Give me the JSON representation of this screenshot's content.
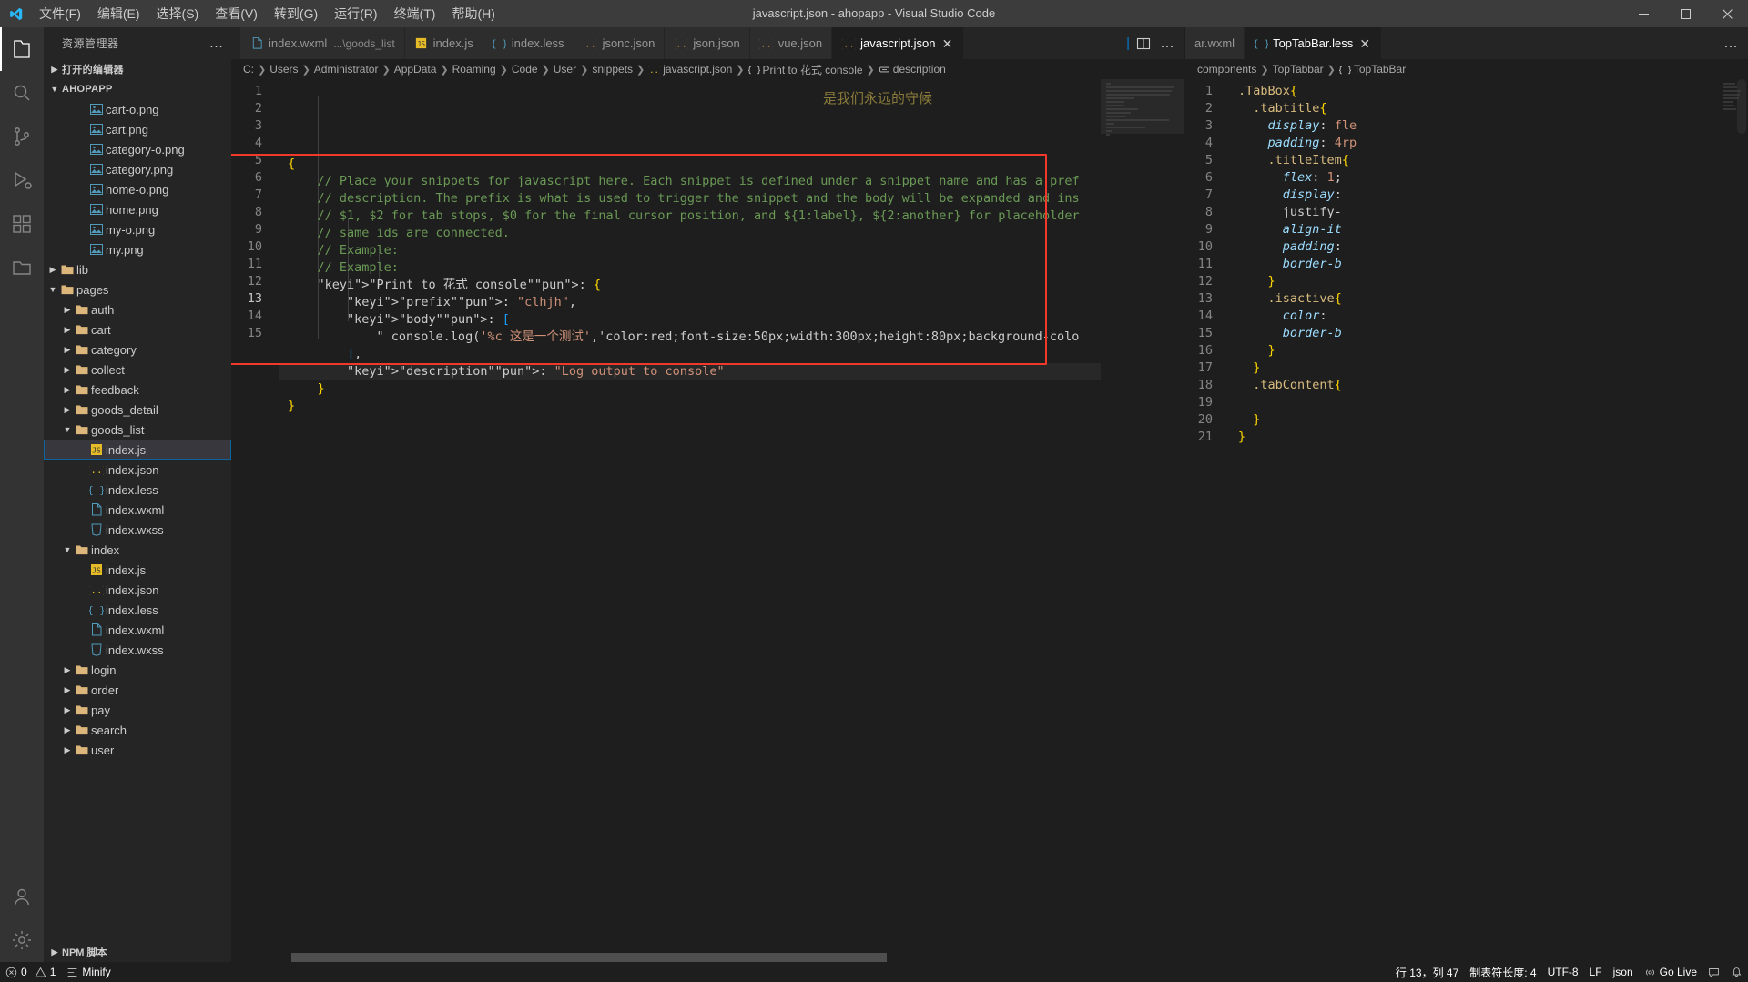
{
  "window": {
    "title": "javascript.json - ahopapp - Visual Studio Code",
    "logo_icon": "vscode-logo",
    "minimize_icon": "minimize-icon",
    "maximize_icon": "maximize-icon",
    "close_icon": "close-icon"
  },
  "menubar": [
    {
      "label": "文件(F)",
      "name": "menu-file"
    },
    {
      "label": "编辑(E)",
      "name": "menu-edit"
    },
    {
      "label": "选择(S)",
      "name": "menu-selection"
    },
    {
      "label": "查看(V)",
      "name": "menu-view"
    },
    {
      "label": "转到(G)",
      "name": "menu-go"
    },
    {
      "label": "运行(R)",
      "name": "menu-run"
    },
    {
      "label": "终端(T)",
      "name": "menu-terminal"
    },
    {
      "label": "帮助(H)",
      "name": "menu-help"
    }
  ],
  "activitybar": [
    {
      "name": "explorer-icon",
      "active": true
    },
    {
      "name": "search-icon",
      "active": false
    },
    {
      "name": "source-control-icon",
      "active": false
    },
    {
      "name": "run-debug-icon",
      "active": false
    },
    {
      "name": "extensions-icon",
      "active": false
    },
    {
      "name": "remote-explorer-icon",
      "active": false
    },
    {
      "name": "account-icon",
      "active": false
    },
    {
      "name": "settings-gear-icon",
      "active": false
    }
  ],
  "sidebar": {
    "header_title": "资源管理器",
    "more_actions": "…",
    "open_editors_label": "打开的编辑器",
    "project_label": "AHOPAPP",
    "npm_scripts_label": "NPM 脚本",
    "tree": [
      {
        "label": "cart-o.png",
        "depth": 3,
        "type": "img",
        "expand": ""
      },
      {
        "label": "cart.png",
        "depth": 3,
        "type": "img",
        "expand": ""
      },
      {
        "label": "category-o.png",
        "depth": 3,
        "type": "img",
        "expand": ""
      },
      {
        "label": "category.png",
        "depth": 3,
        "type": "img",
        "expand": ""
      },
      {
        "label": "home-o.png",
        "depth": 3,
        "type": "img",
        "expand": ""
      },
      {
        "label": "home.png",
        "depth": 3,
        "type": "img",
        "expand": ""
      },
      {
        "label": "my-o.png",
        "depth": 3,
        "type": "img",
        "expand": ""
      },
      {
        "label": "my.png",
        "depth": 3,
        "type": "img",
        "expand": ""
      },
      {
        "label": "lib",
        "depth": 1,
        "type": "folder",
        "expand": "collapsed"
      },
      {
        "label": "pages",
        "depth": 1,
        "type": "folder",
        "expand": "expanded"
      },
      {
        "label": "auth",
        "depth": 2,
        "type": "folder",
        "expand": "collapsed"
      },
      {
        "label": "cart",
        "depth": 2,
        "type": "folder",
        "expand": "collapsed"
      },
      {
        "label": "category",
        "depth": 2,
        "type": "folder",
        "expand": "collapsed"
      },
      {
        "label": "collect",
        "depth": 2,
        "type": "folder",
        "expand": "collapsed"
      },
      {
        "label": "feedback",
        "depth": 2,
        "type": "folder",
        "expand": "collapsed"
      },
      {
        "label": "goods_detail",
        "depth": 2,
        "type": "folder",
        "expand": "collapsed"
      },
      {
        "label": "goods_list",
        "depth": 2,
        "type": "folder",
        "expand": "expanded"
      },
      {
        "label": "index.js",
        "depth": 3,
        "type": "js",
        "expand": "",
        "selected": true
      },
      {
        "label": "index.json",
        "depth": 3,
        "type": "json",
        "expand": ""
      },
      {
        "label": "index.less",
        "depth": 3,
        "type": "less",
        "expand": ""
      },
      {
        "label": "index.wxml",
        "depth": 3,
        "type": "wxml",
        "expand": ""
      },
      {
        "label": "index.wxss",
        "depth": 3,
        "type": "wxss",
        "expand": ""
      },
      {
        "label": "index",
        "depth": 2,
        "type": "folder",
        "expand": "expanded"
      },
      {
        "label": "index.js",
        "depth": 3,
        "type": "js",
        "expand": ""
      },
      {
        "label": "index.json",
        "depth": 3,
        "type": "json",
        "expand": ""
      },
      {
        "label": "index.less",
        "depth": 3,
        "type": "less",
        "expand": ""
      },
      {
        "label": "index.wxml",
        "depth": 3,
        "type": "wxml",
        "expand": ""
      },
      {
        "label": "index.wxss",
        "depth": 3,
        "type": "wxss",
        "expand": ""
      },
      {
        "label": "login",
        "depth": 2,
        "type": "folder",
        "expand": "collapsed"
      },
      {
        "label": "order",
        "depth": 2,
        "type": "folder",
        "expand": "collapsed"
      },
      {
        "label": "pay",
        "depth": 2,
        "type": "folder",
        "expand": "collapsed"
      },
      {
        "label": "search",
        "depth": 2,
        "type": "folder",
        "expand": "collapsed"
      },
      {
        "label": "user",
        "depth": 2,
        "type": "folder",
        "expand": "collapsed"
      }
    ]
  },
  "left_group": {
    "tabs": [
      {
        "label": "index.wxml",
        "description": "...\\goods_list",
        "icon": "wxml-file-icon",
        "active": false,
        "closable": false
      },
      {
        "label": "index.js",
        "description": "",
        "icon": "js-file-icon",
        "active": false,
        "closable": false
      },
      {
        "label": "index.less",
        "description": "",
        "icon": "less-file-icon",
        "active": false,
        "closable": false
      },
      {
        "label": "jsonc.json",
        "description": "",
        "icon": "jsonc-file-icon",
        "active": false,
        "closable": false
      },
      {
        "label": "json.json",
        "description": "",
        "icon": "jsonc-file-icon",
        "active": false,
        "closable": false
      },
      {
        "label": "vue.json",
        "description": "",
        "icon": "jsonc-file-icon",
        "active": false,
        "closable": false
      },
      {
        "label": "javascript.json",
        "description": "",
        "icon": "jsonc-file-icon",
        "active": true,
        "closable": true,
        "close_icon": "close-icon"
      }
    ],
    "actions": {
      "split_icon": "split-editor-icon",
      "more": "…"
    },
    "breadcrumb": [
      {
        "label": "C:",
        "icon": ""
      },
      {
        "label": "Users",
        "icon": ""
      },
      {
        "label": "Administrator",
        "icon": ""
      },
      {
        "label": "AppData",
        "icon": ""
      },
      {
        "label": "Roaming",
        "icon": ""
      },
      {
        "label": "Code",
        "icon": ""
      },
      {
        "label": "User",
        "icon": ""
      },
      {
        "label": "snippets",
        "icon": ""
      },
      {
        "label": "javascript.json",
        "icon": "jsonc-file-icon"
      },
      {
        "label": "Print to 花式 console",
        "icon": "json-object-icon"
      },
      {
        "label": "description",
        "icon": "json-key-icon"
      }
    ],
    "watermark": "是我们永远的守候",
    "code_lines": [
      {
        "n": 1,
        "text": "{"
      },
      {
        "n": 2,
        "text": "    // Place your snippets for javascript here. Each snippet is defined under a snippet name and has a pref"
      },
      {
        "n": 3,
        "text": "    // description. The prefix is what is used to trigger the snippet and the body will be expanded and ins"
      },
      {
        "n": 4,
        "text": "    // $1, $2 for tab stops, $0 for the final cursor position, and ${1:label}, ${2:another} for placeholder"
      },
      {
        "n": 5,
        "text": "    // same ids are connected."
      },
      {
        "n": 6,
        "text": "    // Example:"
      },
      {
        "n": 7,
        "text": "    // Example:"
      },
      {
        "n": 8,
        "text": "    \"Print to 花式 console\": {"
      },
      {
        "n": 9,
        "text": "        \"prefix\": \"clhjh\","
      },
      {
        "n": 10,
        "text": "        \"body\": ["
      },
      {
        "n": 11,
        "text": "            \" console.log('%c 这是一个测试','color:red;font-size:50px;width:300px;height:80px;background-colo"
      },
      {
        "n": 12,
        "text": "        ],"
      },
      {
        "n": 13,
        "text": "        \"description\": \"Log output to console\""
      },
      {
        "n": 14,
        "text": "    }"
      },
      {
        "n": 15,
        "text": "}"
      }
    ],
    "highlight_line": 13
  },
  "right_group": {
    "tabs": [
      {
        "label": "ar.wxml",
        "icon": "",
        "active": false,
        "closable": false
      },
      {
        "label": "TopTabBar.less",
        "icon": "less-file-icon",
        "active": true,
        "closable": true,
        "close_icon": "close-icon"
      }
    ],
    "actions": {
      "more": "…"
    },
    "breadcrumb": [
      {
        "label": "components",
        "icon": ""
      },
      {
        "label": "TopTabbar",
        "icon": ""
      },
      {
        "label": "TopTabBar",
        "icon": "css-rule-icon"
      }
    ],
    "code_lines": [
      {
        "n": 1,
        "text": ".TabBox{"
      },
      {
        "n": 2,
        "text": "  .tabtitle{"
      },
      {
        "n": 3,
        "text": "    display: fle"
      },
      {
        "n": 4,
        "text": "    padding: 4rp"
      },
      {
        "n": 5,
        "text": "    .titleItem{"
      },
      {
        "n": 6,
        "text": "      flex: 1;"
      },
      {
        "n": 7,
        "text": "      display:"
      },
      {
        "n": 8,
        "text": "      justify-"
      },
      {
        "n": 9,
        "text": "      align-it"
      },
      {
        "n": 10,
        "text": "      padding:"
      },
      {
        "n": 11,
        "text": "      border-b"
      },
      {
        "n": 12,
        "text": "    }"
      },
      {
        "n": 13,
        "text": "    .isactive{"
      },
      {
        "n": 14,
        "text": "      color: "
      },
      {
        "n": 15,
        "text": "      border-b"
      },
      {
        "n": 16,
        "text": "    }"
      },
      {
        "n": 17,
        "text": "  }"
      },
      {
        "n": 18,
        "text": "  .tabContent{"
      },
      {
        "n": 19,
        "text": ""
      },
      {
        "n": 20,
        "text": "  }"
      },
      {
        "n": 21,
        "text": "}"
      }
    ]
  },
  "statusbar": {
    "errors": "0",
    "warnings": "1",
    "error_icon": "error-icon",
    "warning_icon": "warning-icon",
    "minify_label": "Minify",
    "minify_icon": "minify-icon",
    "cursor_position": "行 13，列 47",
    "indent": "制表符长度: 4",
    "encoding": "UTF-8",
    "eol": "LF",
    "language": "json",
    "golive_label": "Go Live",
    "golive_icon": "broadcast-icon",
    "feedback_icon": "feedback-icon",
    "bell_icon": "bell-icon"
  },
  "annotation": {
    "redbox_color": "#f0392b"
  }
}
